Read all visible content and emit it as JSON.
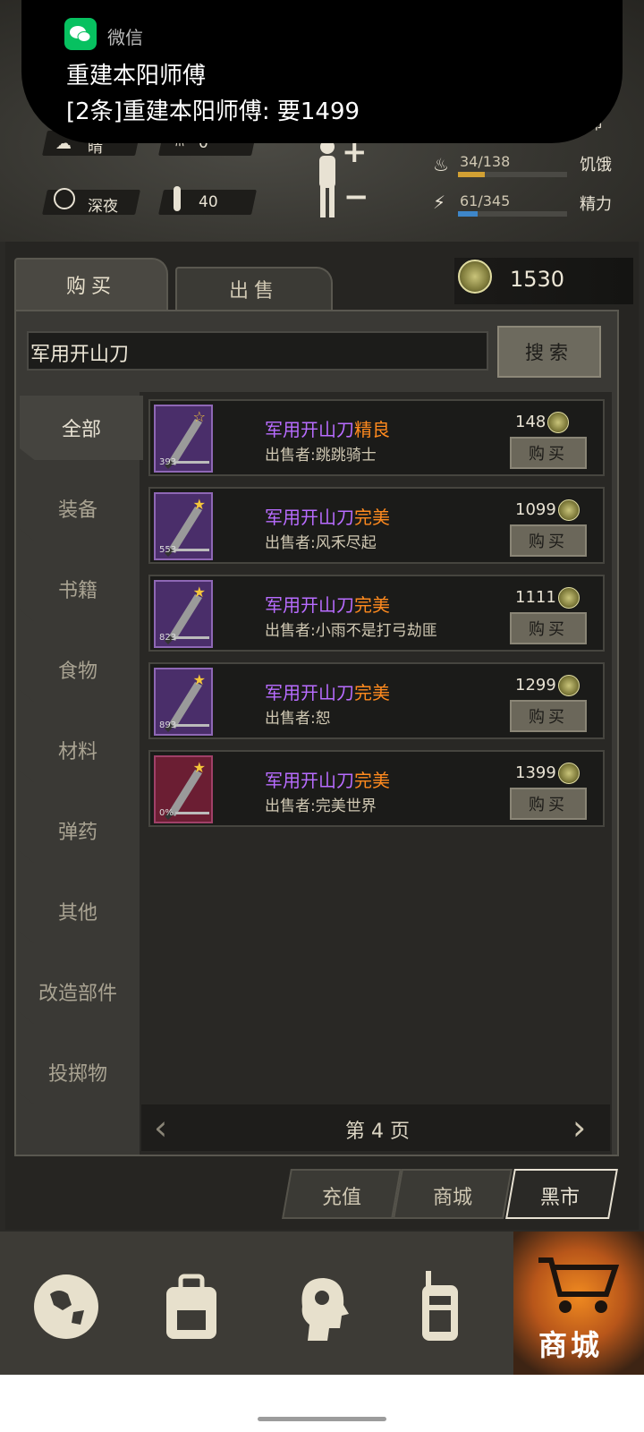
{
  "notification": {
    "app": "微信",
    "title": "重建本阳师傅",
    "message": "[2条]重建本阳师傅: 要1499"
  },
  "status": {
    "weather": "晴",
    "weather_count": "0",
    "time_of_day": "深夜",
    "temperature": "40",
    "life_label": "生命",
    "hunger": {
      "value": "34/138",
      "label": "饥饿",
      "fraction": 0.246
    },
    "energy": {
      "value": "61/345",
      "label": "精力",
      "fraction": 0.177
    }
  },
  "trade": {
    "tabs": [
      {
        "label": "购买"
      },
      {
        "label": "出售"
      }
    ],
    "coins": "1530",
    "search": {
      "value": "军用开山刀",
      "button": "搜索"
    }
  },
  "categories": [
    {
      "label": "全部"
    },
    {
      "label": "装备"
    },
    {
      "label": "书籍"
    },
    {
      "label": "食物"
    },
    {
      "label": "材料"
    },
    {
      "label": "弹药"
    },
    {
      "label": "其他"
    },
    {
      "label": "改造部件"
    },
    {
      "label": "投掷物"
    }
  ],
  "listings": [
    {
      "name": "军用开山刀",
      "quality": "精良",
      "seller": "出售者:跳跳骑士",
      "price": "148",
      "level": "393",
      "buy": "购买"
    },
    {
      "name": "军用开山刀",
      "quality": "完美",
      "seller": "出售者:风禾尽起",
      "price": "1099",
      "level": "553",
      "buy": "购买"
    },
    {
      "name": "军用开山刀",
      "quality": "完美",
      "seller": "出售者:小雨不是打弓劫匪",
      "price": "1111",
      "level": "823",
      "buy": "购买"
    },
    {
      "name": "军用开山刀",
      "quality": "完美",
      "seller": "出售者:恕",
      "price": "1299",
      "level": "893",
      "buy": "购买"
    },
    {
      "name": "军用开山刀",
      "quality": "完美",
      "seller": "出售者:完美世界",
      "price": "1399",
      "level": "0%",
      "buy": "购买"
    }
  ],
  "pagination": {
    "label": "第 4 页"
  },
  "store_tabs": [
    {
      "label": "充值"
    },
    {
      "label": "商城"
    },
    {
      "label": "黑市"
    }
  ],
  "bottom_nav": {
    "shop_label": "商城"
  },
  "colors": {
    "item_name": "#b86cff",
    "quality": "#ff8a1e",
    "panel": "#262522",
    "shop_accent": "#e0741a"
  }
}
